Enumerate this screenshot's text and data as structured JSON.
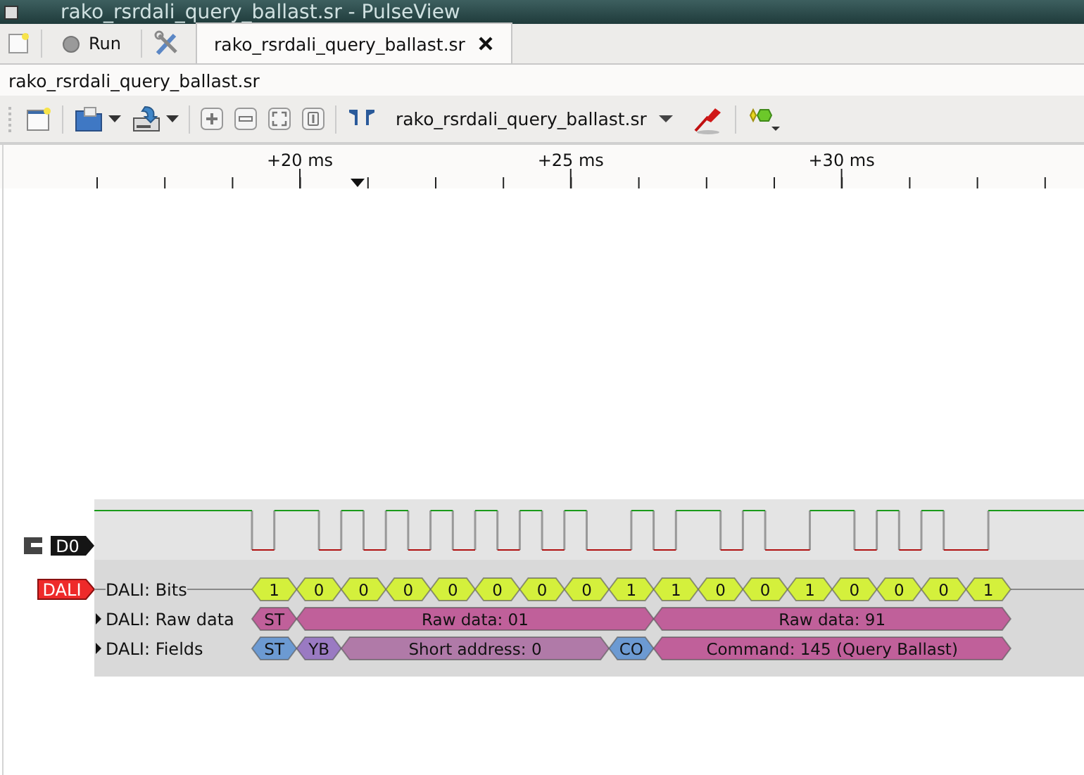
{
  "window": {
    "title": "rako_rsrdali_query_ballast.sr - PulseView"
  },
  "run_button": {
    "label": "Run"
  },
  "tabs": [
    {
      "label": "rako_rsrdali_query_ballast.sr",
      "selected": true
    }
  ],
  "session_label": "rako_rsrdali_query_ballast.sr",
  "toolbar": {
    "device": "rako_rsrdali_query_ballast.sr"
  },
  "ruler": {
    "labels": [
      "+20 ms",
      "+25 ms",
      "+30 ms"
    ]
  },
  "channels": [
    {
      "name": "D0"
    }
  ],
  "decoder": {
    "name": "DALI",
    "rows": [
      {
        "label": "DALI: Bits",
        "expandable": false,
        "annotations": [
          {
            "text": "1",
            "kind": "bit",
            "color": "#d4f03c"
          },
          {
            "text": "0",
            "kind": "bit",
            "color": "#d4f03c"
          },
          {
            "text": "0",
            "kind": "bit",
            "color": "#d4f03c"
          },
          {
            "text": "0",
            "kind": "bit",
            "color": "#d4f03c"
          },
          {
            "text": "0",
            "kind": "bit",
            "color": "#d4f03c"
          },
          {
            "text": "0",
            "kind": "bit",
            "color": "#d4f03c"
          },
          {
            "text": "0",
            "kind": "bit",
            "color": "#d4f03c"
          },
          {
            "text": "0",
            "kind": "bit",
            "color": "#d4f03c"
          },
          {
            "text": "1",
            "kind": "bit",
            "color": "#d4f03c"
          },
          {
            "text": "1",
            "kind": "bit",
            "color": "#d4f03c"
          },
          {
            "text": "0",
            "kind": "bit",
            "color": "#d4f03c"
          },
          {
            "text": "0",
            "kind": "bit",
            "color": "#d4f03c"
          },
          {
            "text": "1",
            "kind": "bit",
            "color": "#d4f03c"
          },
          {
            "text": "0",
            "kind": "bit",
            "color": "#d4f03c"
          },
          {
            "text": "0",
            "kind": "bit",
            "color": "#d4f03c"
          },
          {
            "text": "0",
            "kind": "bit",
            "color": "#d4f03c"
          },
          {
            "text": "1",
            "kind": "bit",
            "color": "#d4f03c"
          }
        ]
      },
      {
        "label": "DALI: Raw data",
        "expandable": true,
        "annotations": [
          {
            "text": "ST",
            "kind": "flag",
            "color": "#c0609a"
          },
          {
            "text": "Raw data: 01",
            "kind": "byte",
            "color": "#c0609a"
          },
          {
            "text": "Raw data: 91",
            "kind": "byte",
            "color": "#c0609a"
          }
        ]
      },
      {
        "label": "DALI: Fields",
        "expandable": true,
        "annotations": [
          {
            "text": "ST",
            "kind": "flag",
            "color": "#6c9ad2"
          },
          {
            "text": "YB",
            "kind": "flag",
            "color": "#9a7ac2"
          },
          {
            "text": "Short address: 0",
            "kind": "address",
            "color": "#b07aa8"
          },
          {
            "text": "CO",
            "kind": "flag",
            "color": "#6c9ad2"
          },
          {
            "text": "Command: 145 (Query Ballast)",
            "kind": "byte",
            "color": "#c0609a"
          }
        ]
      }
    ]
  }
}
